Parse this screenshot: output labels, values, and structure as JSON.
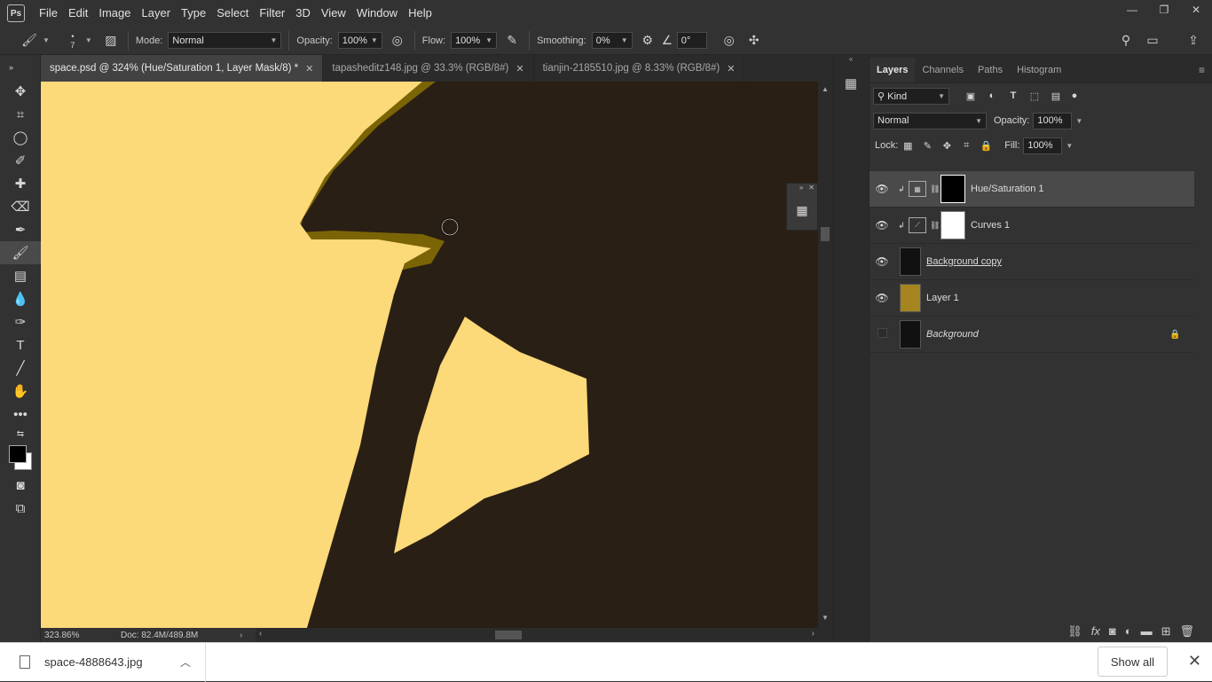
{
  "app": {
    "menu": [
      "File",
      "Edit",
      "Image",
      "Layer",
      "Type",
      "Select",
      "Filter",
      "3D",
      "View",
      "Window",
      "Help"
    ],
    "logo": "Ps"
  },
  "options": {
    "brush_size": "7",
    "mode_label": "Mode:",
    "mode_value": "Normal",
    "opacity_label": "Opacity:",
    "opacity_value": "100%",
    "flow_label": "Flow:",
    "flow_value": "100%",
    "smoothing_label": "Smoothing:",
    "smoothing_value": "0%",
    "angle_value": "0°"
  },
  "tabs": [
    {
      "label": "space.psd @ 324% (Hue/Saturation 1, Layer Mask/8) *",
      "active": true
    },
    {
      "label": "tapasheditz148.jpg @ 33.3% (RGB/8#)",
      "active": false
    },
    {
      "label": "tianjin-2185510.jpg @ 8.33% (RGB/8#)",
      "active": false
    }
  ],
  "status": {
    "zoom": "323.86%",
    "doc": "Doc: 82.4M/489.8M"
  },
  "layers_panel": {
    "tabs": [
      "Layers",
      "Channels",
      "Paths",
      "Histogram"
    ],
    "kind_label": "Kind",
    "blend_mode": "Normal",
    "opacity_label": "Opacity:",
    "opacity_value": "100%",
    "lock_label": "Lock:",
    "fill_label": "Fill:",
    "fill_value": "100%",
    "layers": [
      {
        "name": "Hue/Saturation 1",
        "selected": true
      },
      {
        "name": "Curves 1",
        "selected": false
      },
      {
        "name": "Background copy",
        "selected": false
      },
      {
        "name": "Layer 1",
        "selected": false
      },
      {
        "name": "Background",
        "selected": false
      }
    ]
  },
  "downloads": {
    "file": "space-4888643.jpg",
    "show_all": "Show all"
  },
  "colors": {
    "canvas_light": "#fcd979",
    "canvas_dark": "#2a1f14",
    "mask_edge": "#7a6406"
  }
}
